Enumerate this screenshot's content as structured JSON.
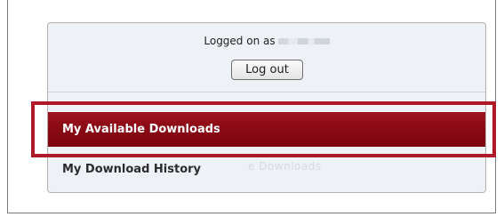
{
  "session": {
    "logged_on_prefix": "Logged on as",
    "username_masked": true
  },
  "buttons": {
    "logout_label": "Log out"
  },
  "nav": {
    "items": [
      {
        "label": "My Available Downloads",
        "state": "selected"
      },
      {
        "label": "My Download History",
        "state": "default"
      }
    ],
    "ghost_text": "e Downloads"
  },
  "colors": {
    "selected_background": "#8a0a14",
    "highlight_outline": "#b0182a",
    "panel_background": "#eef1f6"
  }
}
